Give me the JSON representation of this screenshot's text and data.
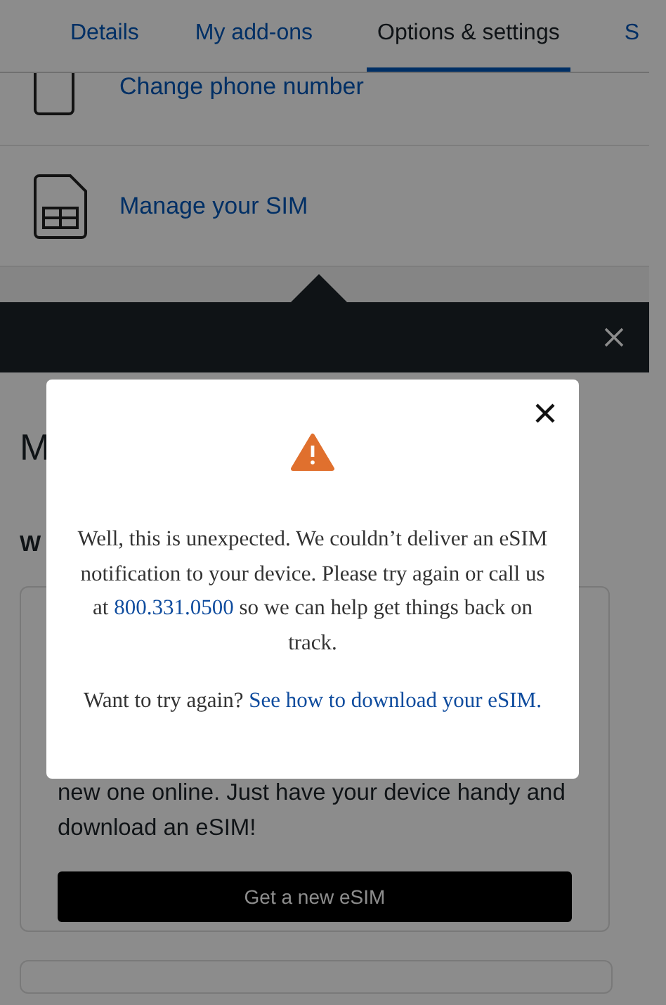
{
  "tabs": [
    {
      "label": "Details",
      "selected": false
    },
    {
      "label": "My add-ons",
      "selected": false
    },
    {
      "label": "Options & settings",
      "selected": true
    },
    {
      "label": "S",
      "selected": false
    }
  ],
  "options": [
    {
      "kind": "phone",
      "label": "Change phone number"
    },
    {
      "kind": "sim",
      "label": "Manage your SIM"
    }
  ],
  "section": {
    "heading": "M",
    "subheading": "W"
  },
  "card": {
    "text_lines": [
      "new one online. Just have your device handy and",
      "download an eSIM!"
    ],
    "button": "Get a new eSIM"
  },
  "dialog": {
    "message": {
      "before": "Well, this is unexpected. We couldn’t deliver an eSIM notification to your device. Please try again or call us at ",
      "phone": "800.331.0500",
      "after": " so we can help get things back on track."
    },
    "retry": {
      "text": "Want to try again? ",
      "link": "See how to download your eSIM."
    }
  }
}
